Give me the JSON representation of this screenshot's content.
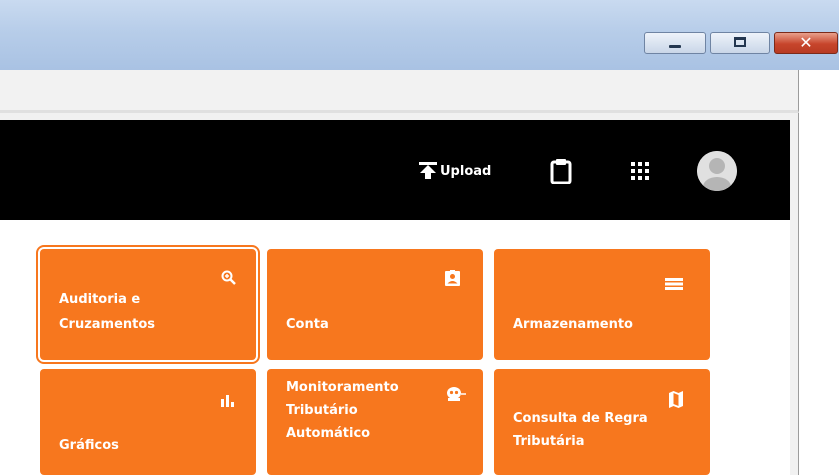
{
  "toolbar": {
    "upload_label": "Upload"
  },
  "window": {
    "close_symbol": "✕"
  },
  "tiles": [
    {
      "label_line1": "Auditoria e",
      "label_line2": "Cruzamentos",
      "icon": "zoom-in-icon"
    },
    {
      "label_line1": "Conta",
      "icon": "account-box-icon"
    },
    {
      "label_line1": "Armazenamento",
      "icon": "storage-icon"
    },
    {
      "label_line1": "Gráficos",
      "icon": "bar-chart-icon"
    },
    {
      "label_line1": "Monitoramento",
      "label_line2": "Tributário",
      "label_line3": "Automático",
      "icon": "robot-icon"
    },
    {
      "label_line1": "Consulta de Regra",
      "label_line2": "Tributária",
      "icon": "map-icon"
    }
  ],
  "colors": {
    "tile_bg": "#f7771e",
    "appbar_bg": "#000000"
  }
}
